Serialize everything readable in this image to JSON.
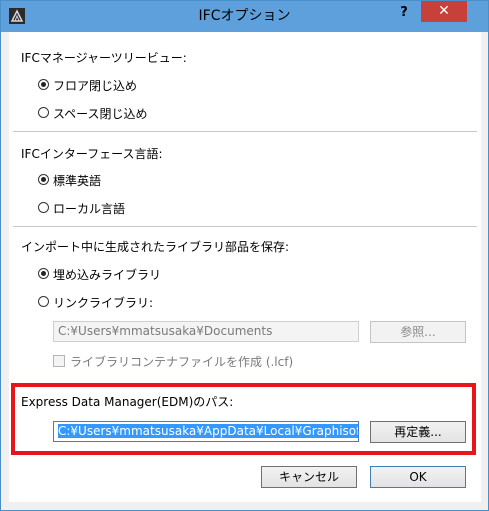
{
  "window": {
    "title": "IFCオプション",
    "help_label": "?",
    "close_label": "✕"
  },
  "section1": {
    "heading": "IFCマネージャーツリービュー:",
    "options": [
      {
        "label": "フロア閉じ込め",
        "selected": true
      },
      {
        "label": "スペース閉じ込め",
        "selected": false
      }
    ]
  },
  "section2": {
    "heading": "IFCインターフェース言語:",
    "options": [
      {
        "label": "標準英語",
        "selected": true
      },
      {
        "label": "ローカル言語",
        "selected": false
      }
    ]
  },
  "section3": {
    "heading": "インポート中に生成されたライブラリ部品を保存:",
    "options": [
      {
        "label": "埋め込みライブラリ",
        "selected": true
      },
      {
        "label": "リンクライブラリ:",
        "selected": false
      }
    ],
    "path_value": "C:¥Users¥mmatsusaka¥Documents",
    "browse_label": "参照...",
    "container_checkbox_label": "ライブラリコンテナファイルを作成 (.lcf)"
  },
  "edm": {
    "heading": "Express Data Manager(EDM)のパス:",
    "path_value": "C:¥Users¥mmatsusaka¥AppData¥Local¥Graphisoft¥",
    "redefine_label": "再定義..."
  },
  "footer": {
    "cancel_label": "キャンセル",
    "ok_label": "OK"
  },
  "colors": {
    "titlebar": "#5ea0dc",
    "close_button": "#c7403a",
    "highlight_border": "#e8151b",
    "selection": "#3399ff"
  }
}
